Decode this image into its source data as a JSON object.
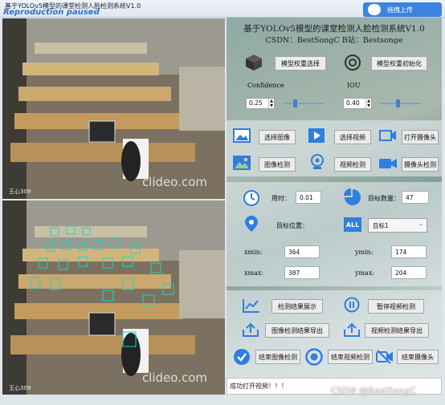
{
  "window": {
    "title": "基于YOLOv5模型的课堂检测人脸检测系统V1.0",
    "overlay": "Reproduction paused",
    "upload_label": "拖拽上传"
  },
  "videos": {
    "watermark": "clideo.com",
    "corner_text": "王心309"
  },
  "panel": {
    "title": "基于YOLOv5模型的课堂检测人脸检测系统V1.0",
    "credits": "CSDN：BestSongC   B站：Bestsonge",
    "model_select": "模型权重选择",
    "model_init": "模型权重初始化",
    "confidence_label": "Confidence",
    "iou_label": "IOU",
    "confidence_value": "0.25",
    "iou_value": "0.40",
    "confidence_level": 0.25,
    "iou_level": 0.4,
    "select_image": "选择图像",
    "select_video": "选择视频",
    "open_camera": "打开摄像头",
    "image_detect": "图像检测",
    "video_detect": "视频检测",
    "camera_detect": "摄像头检测",
    "time_label": "用时：",
    "time_value": "0.01",
    "count_label": "目标数量：",
    "count_value": "47",
    "pos_label": "目标位置：",
    "target_select": "目标1",
    "xmin_label": "xmin:",
    "xmin_value": "364",
    "ymin_label": "ymin:",
    "ymin_value": "174",
    "xmax_label": "xmax:",
    "xmax_value": "387",
    "ymax_label": "ymax:",
    "ymax_value": "204",
    "show_result": "检测结果展示",
    "pause_video": "暂停视频检测",
    "export_image": "图像检测结果导出",
    "export_video": "视频检测结果导出",
    "end_image": "结束图像检测",
    "end_video": "结束视频检测",
    "end_camera": "结束摄像头"
  },
  "status": "成功打开视频！！！",
  "page_watermark": "CSDN @BestSongC",
  "colors": {
    "accent": "#3a84e0",
    "icon_blue": "#2f7ee0",
    "detect_box": "#19d6c6"
  }
}
